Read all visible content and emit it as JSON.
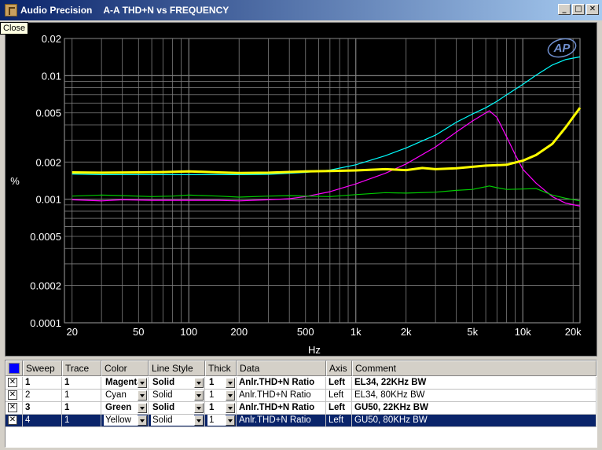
{
  "window": {
    "app_name": "Audio Precision",
    "title": "A-A THD+N vs FREQUENCY",
    "buttons": {
      "minimize": "_",
      "maximize": "□",
      "close": "✕"
    },
    "tooltip": "Close"
  },
  "logo_text": "AP",
  "colors": {
    "background": "#000000",
    "grid": "#808080",
    "titlebar": "#0a246a"
  },
  "chart_data": {
    "type": "line",
    "xlabel": "Hz",
    "ylabel": "%",
    "x_scale": "log",
    "y_scale": "log",
    "xlim": [
      18,
      22000
    ],
    "ylim": [
      0.0001,
      0.02
    ],
    "x_ticks": [
      {
        "v": 20,
        "label": "20"
      },
      {
        "v": 50,
        "label": "50"
      },
      {
        "v": 100,
        "label": "100"
      },
      {
        "v": 200,
        "label": "200"
      },
      {
        "v": 500,
        "label": "500"
      },
      {
        "v": 1000,
        "label": "1k"
      },
      {
        "v": 2000,
        "label": "2k"
      },
      {
        "v": 5000,
        "label": "5k"
      },
      {
        "v": 10000,
        "label": "10k"
      },
      {
        "v": 20000,
        "label": "20k"
      }
    ],
    "y_ticks": [
      {
        "v": 0.02,
        "label": "0.02"
      },
      {
        "v": 0.01,
        "label": "0.01"
      },
      {
        "v": 0.005,
        "label": "0.005"
      },
      {
        "v": 0.002,
        "label": "0.002"
      },
      {
        "v": 0.001,
        "label": "0.001"
      },
      {
        "v": 0.0005,
        "label": "0.0005"
      },
      {
        "v": 0.0002,
        "label": "0.0002"
      },
      {
        "v": 0.0001,
        "label": "0.0001"
      }
    ],
    "grid": true,
    "series": [
      {
        "name": "EL34, 22KHz BW",
        "color": "#ff00ff",
        "width": 1.2,
        "points": [
          [
            20,
            0.00099
          ],
          [
            30,
            0.00097
          ],
          [
            40,
            0.00099
          ],
          [
            60,
            0.00098
          ],
          [
            100,
            0.00098
          ],
          [
            150,
            0.00098
          ],
          [
            200,
            0.00097
          ],
          [
            300,
            0.00099
          ],
          [
            400,
            0.00101
          ],
          [
            500,
            0.00105
          ],
          [
            700,
            0.00115
          ],
          [
            1000,
            0.00133
          ],
          [
            1500,
            0.00162
          ],
          [
            2000,
            0.00193
          ],
          [
            3000,
            0.00265
          ],
          [
            4000,
            0.0035
          ],
          [
            5000,
            0.0043
          ],
          [
            6300,
            0.0052
          ],
          [
            7000,
            0.0046
          ],
          [
            8000,
            0.0032
          ],
          [
            9000,
            0.0023
          ],
          [
            10000,
            0.00175
          ],
          [
            12000,
            0.00135
          ],
          [
            15000,
            0.00105
          ],
          [
            18000,
            0.00093
          ],
          [
            22000,
            0.00088
          ]
        ]
      },
      {
        "name": "EL34, 80KHz BW",
        "color": "#00ffff",
        "width": 1.2,
        "points": [
          [
            20,
            0.0016
          ],
          [
            30,
            0.00158
          ],
          [
            50,
            0.00158
          ],
          [
            100,
            0.00158
          ],
          [
            200,
            0.00158
          ],
          [
            300,
            0.00159
          ],
          [
            500,
            0.00165
          ],
          [
            700,
            0.00172
          ],
          [
            1000,
            0.0019
          ],
          [
            1500,
            0.00225
          ],
          [
            2000,
            0.0026
          ],
          [
            3000,
            0.0033
          ],
          [
            4000,
            0.0042
          ],
          [
            5000,
            0.0049
          ],
          [
            6000,
            0.0055
          ],
          [
            7000,
            0.0062
          ],
          [
            8000,
            0.007
          ],
          [
            10000,
            0.0085
          ],
          [
            12000,
            0.0101
          ],
          [
            15000,
            0.0122
          ],
          [
            18000,
            0.0135
          ],
          [
            22000,
            0.0142
          ]
        ]
      },
      {
        "name": "GU50, 22KHz BW",
        "color": "#00cc00",
        "width": 1.2,
        "points": [
          [
            20,
            0.00106
          ],
          [
            30,
            0.00108
          ],
          [
            40,
            0.00107
          ],
          [
            60,
            0.00105
          ],
          [
            80,
            0.00106
          ],
          [
            100,
            0.00108
          ],
          [
            150,
            0.00106
          ],
          [
            200,
            0.00104
          ],
          [
            300,
            0.00106
          ],
          [
            400,
            0.00107
          ],
          [
            500,
            0.00106
          ],
          [
            700,
            0.00105
          ],
          [
            1000,
            0.00109
          ],
          [
            1500,
            0.00113
          ],
          [
            2000,
            0.00112
          ],
          [
            3000,
            0.00114
          ],
          [
            4000,
            0.00118
          ],
          [
            5000,
            0.0012
          ],
          [
            6300,
            0.00128
          ],
          [
            7000,
            0.00124
          ],
          [
            8000,
            0.0012
          ],
          [
            10000,
            0.00121
          ],
          [
            12000,
            0.00122
          ],
          [
            15000,
            0.00108
          ],
          [
            18000,
            0.00102
          ],
          [
            22000,
            0.00097
          ]
        ]
      },
      {
        "name": "GU50, 80KHz BW",
        "color": "#ffff00",
        "width": 3,
        "points": [
          [
            20,
            0.00165
          ],
          [
            30,
            0.00164
          ],
          [
            50,
            0.00165
          ],
          [
            70,
            0.00166
          ],
          [
            100,
            0.00168
          ],
          [
            150,
            0.00165
          ],
          [
            200,
            0.00163
          ],
          [
            300,
            0.00164
          ],
          [
            500,
            0.00168
          ],
          [
            700,
            0.00169
          ],
          [
            1000,
            0.00171
          ],
          [
            1500,
            0.00175
          ],
          [
            2000,
            0.00172
          ],
          [
            2500,
            0.00179
          ],
          [
            3000,
            0.00175
          ],
          [
            4000,
            0.00178
          ],
          [
            5000,
            0.00183
          ],
          [
            6000,
            0.00187
          ],
          [
            8000,
            0.0019
          ],
          [
            10000,
            0.00205
          ],
          [
            12000,
            0.00228
          ],
          [
            15000,
            0.0028
          ],
          [
            18000,
            0.0038
          ],
          [
            22000,
            0.0055
          ]
        ]
      }
    ]
  },
  "table": {
    "headers": {
      "sweep": "Sweep",
      "trace": "Trace",
      "color": "Color",
      "line_style": "Line Style",
      "thick": "Thick",
      "data": "Data",
      "axis": "Axis",
      "comment": "Comment"
    },
    "rows": [
      {
        "checked": "✕",
        "sweep": "1",
        "trace": "1",
        "color": "Magenta",
        "line_style": "Solid",
        "thick": "1",
        "data": "Anlr.THD+N Ratio",
        "axis": "Left",
        "comment": "EL34, 22KHz BW",
        "bold": true,
        "selected": false
      },
      {
        "checked": "✕",
        "sweep": "2",
        "trace": "1",
        "color": "Cyan",
        "line_style": "Solid",
        "thick": "1",
        "data": "Anlr.THD+N Ratio",
        "axis": "Left",
        "comment": "EL34, 80KHz BW",
        "bold": false,
        "selected": false
      },
      {
        "checked": "✕",
        "sweep": "3",
        "trace": "1",
        "color": "Green",
        "line_style": "Solid",
        "thick": "1",
        "data": "Anlr.THD+N Ratio",
        "axis": "Left",
        "comment": "GU50, 22KHz BW",
        "bold": true,
        "selected": false
      },
      {
        "checked": "✕",
        "sweep": "4",
        "trace": "1",
        "color": "Yellow",
        "line_style": "Solid",
        "thick": "1",
        "data": "Anlr.THD+N Ratio",
        "axis": "Left",
        "comment": "GU50, 80KHz BW",
        "bold": false,
        "selected": true
      }
    ]
  }
}
